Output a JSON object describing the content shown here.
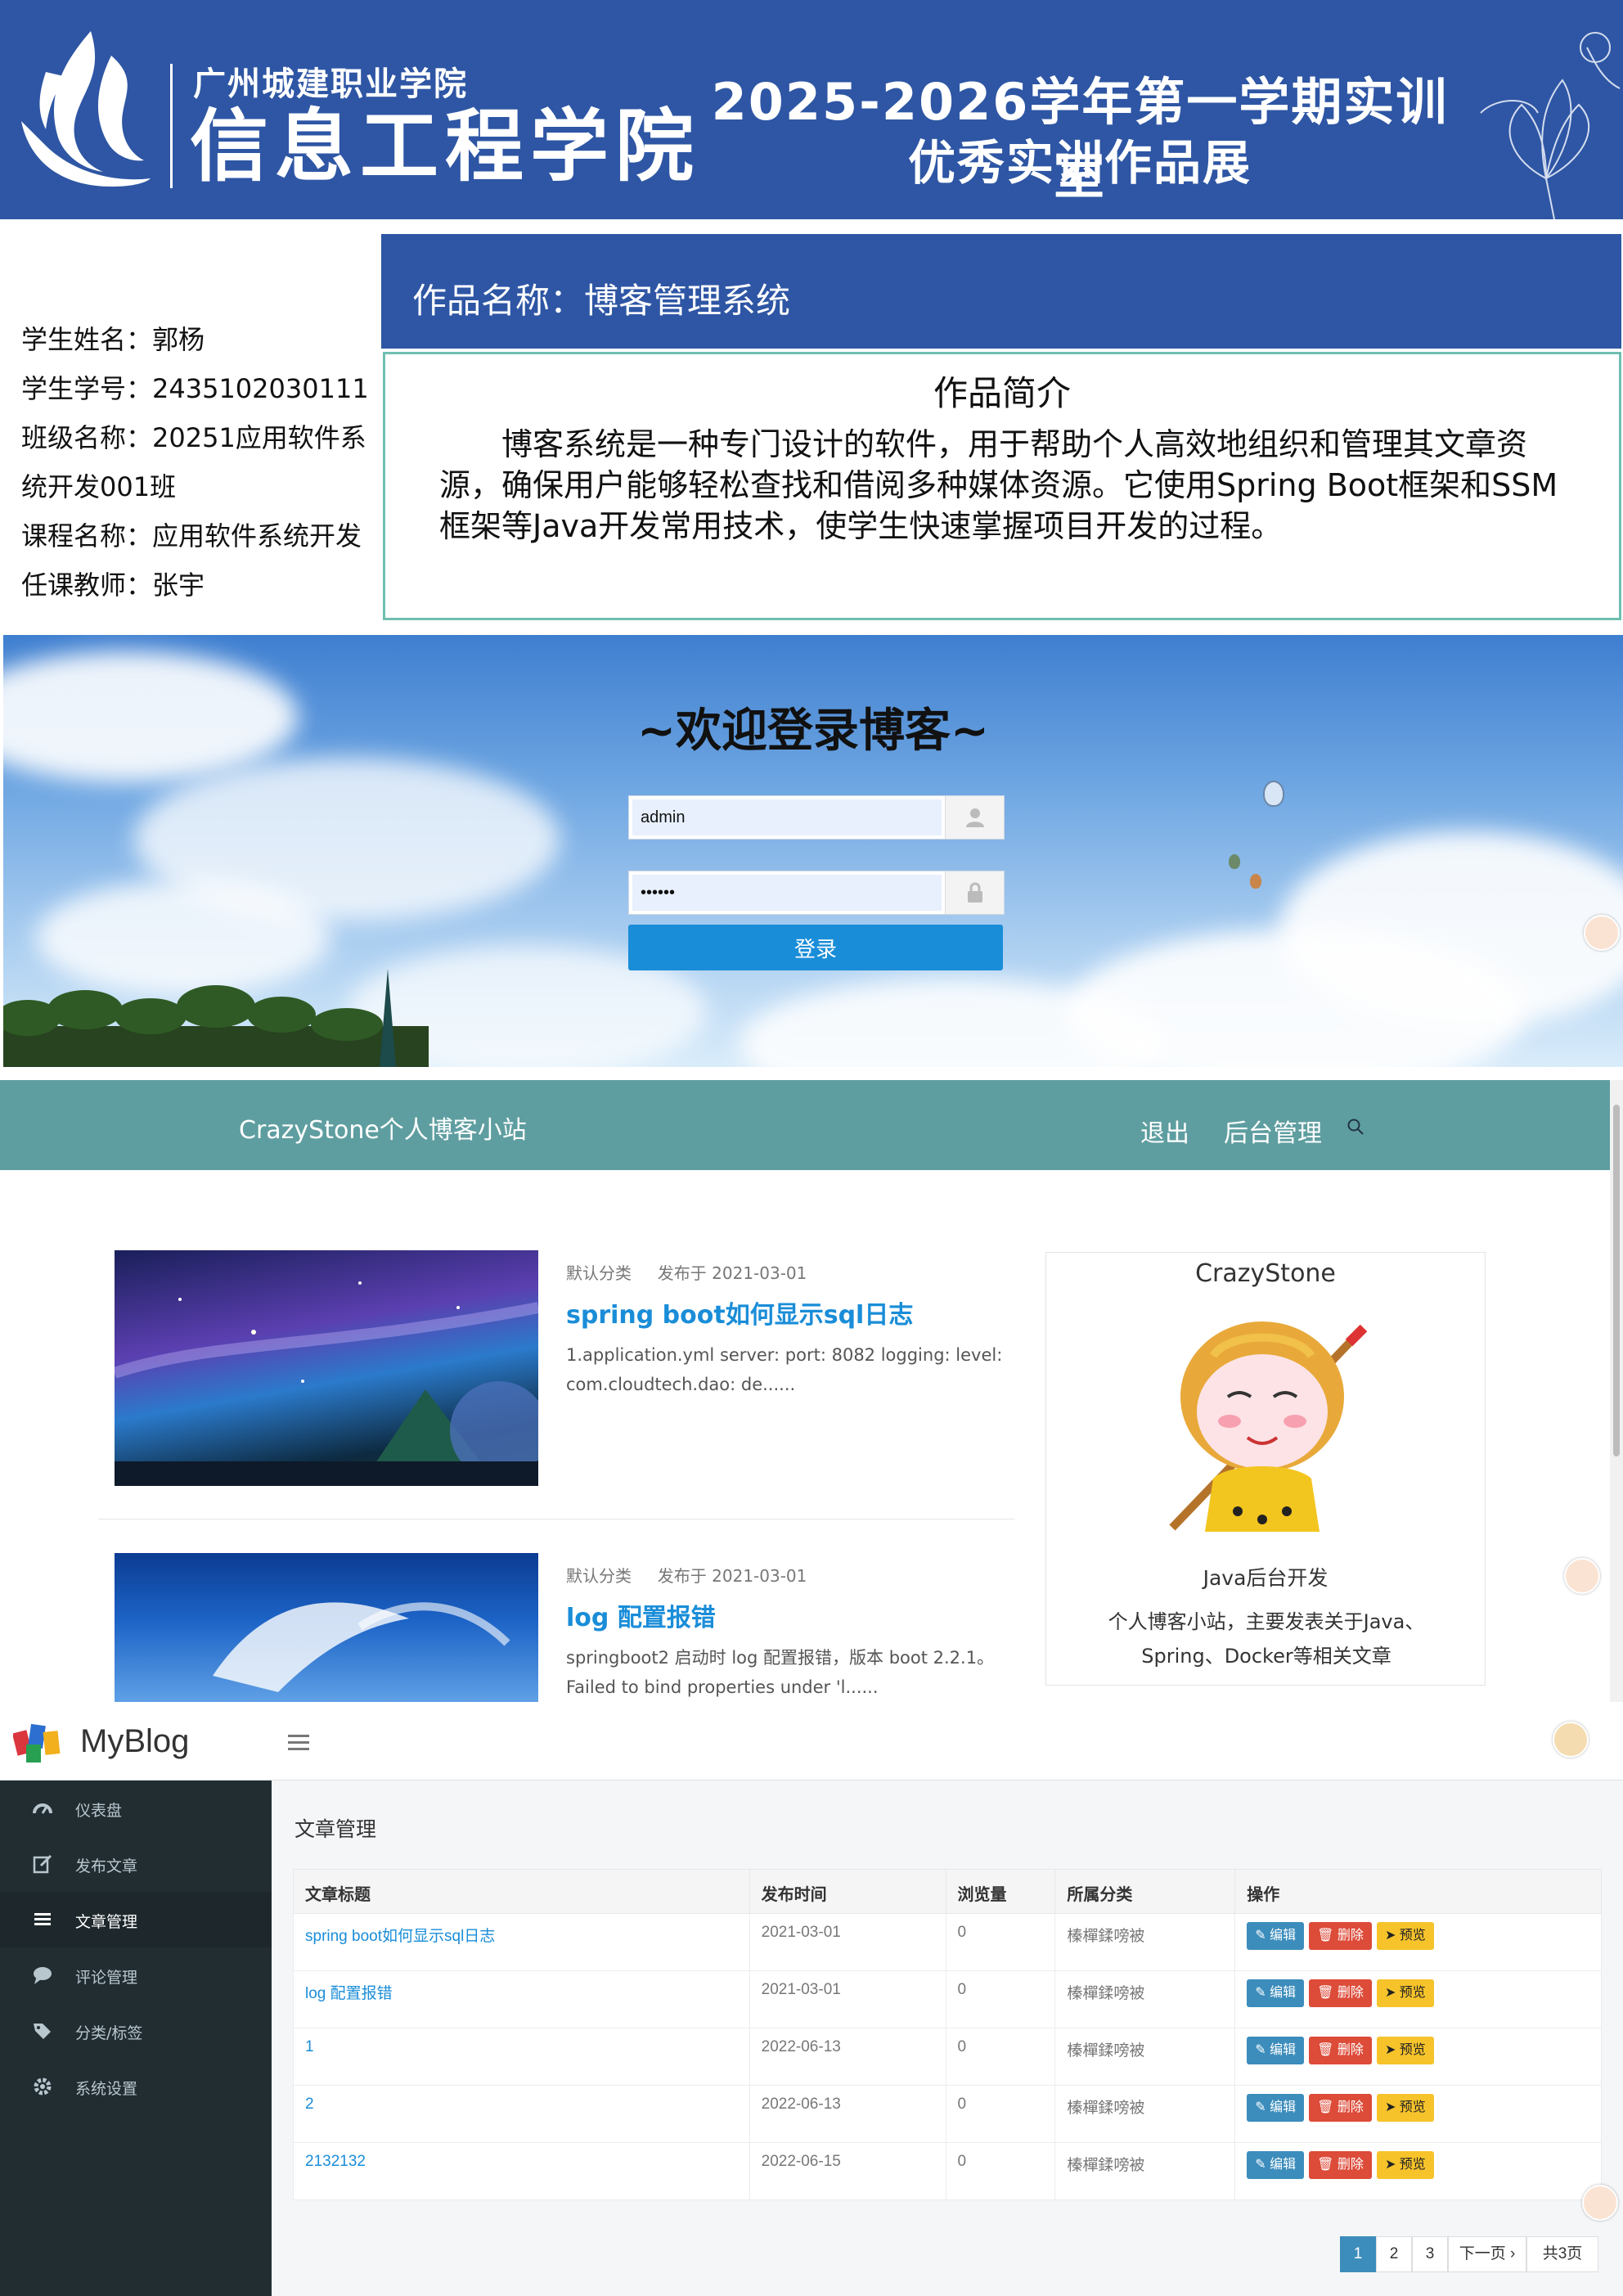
{
  "banner": {
    "school": "广州城建职业学院",
    "college": "信息工程学院",
    "title_line1": "2025-2026学年第一学期实训室",
    "title_line2": "优秀实训作品展"
  },
  "work": {
    "name": "作品名称：博客管理系统",
    "intro_title": "作品简介",
    "intro_text": "博客系统是一种专门设计的软件，用于帮助个人高效地组织和管理其文章资源，确保用户能够轻松查找和借阅多种媒体资源。它使用Spring Boot框架和SSM框架等Java开发常用技术，使学生快速掌握项目开发的过程。"
  },
  "student": {
    "name": "学生姓名：郭杨",
    "id": "学生学号：2435102030111",
    "class_line1": "班级名称：20251应用软件系",
    "class_line2": "统开发001班",
    "course": "课程名称：应用软件系统开发",
    "teacher": "任课教师：张宇"
  },
  "login": {
    "title": "~欢迎登录博客~",
    "username": "admin",
    "password": "••••••",
    "button": "登录"
  },
  "blog": {
    "brand": "CrazyStone个人博客小站",
    "nav_logout": "退出",
    "nav_admin": "后台管理",
    "posts": [
      {
        "category": "默认分类",
        "date": "发布于 2021-03-01",
        "title": "spring boot如何显示sql日志",
        "excerpt": "1.application.yml server: port: 8082 logging: level: com.cloudtech.dao: de......"
      },
      {
        "category": "默认分类",
        "date": "发布于 2021-03-01",
        "title": "log 配置报错",
        "excerpt": "springboot2 启动时 log 配置报错，版本 boot 2.2.1。 Failed to bind properties under 'l......"
      }
    ],
    "profile": {
      "name": "CrazyStone",
      "role": "Java后台开发",
      "desc": "个人博客小站，主要发表关于Java、Spring、Docker等相关文章"
    }
  },
  "admin": {
    "brand": "MyBlog",
    "menu": [
      {
        "label": "仪表盘"
      },
      {
        "label": "发布文章"
      },
      {
        "label": "文章管理"
      },
      {
        "label": "评论管理"
      },
      {
        "label": "分类/标签"
      },
      {
        "label": "系统设置"
      }
    ],
    "section_title": "文章管理",
    "table": {
      "headers": [
        "文章标题",
        "发布时间",
        "浏览量",
        "所属分类",
        "操作"
      ],
      "rows": [
        [
          "spring boot如何显示sql日志",
          "2021-03-01",
          "0",
          "榛樿鍒嗙被"
        ],
        [
          "log 配置报错",
          "2021-03-01",
          "0",
          "榛樿鍒嗙被"
        ],
        [
          "1",
          "2022-06-13",
          "0",
          "榛樿鍒嗙被"
        ],
        [
          "2",
          "2022-06-13",
          "0",
          "榛樿鍒嗙被"
        ],
        [
          "2132132",
          "2022-06-15",
          "0",
          "榛樿鍒嗙被"
        ]
      ],
      "actions": {
        "edit": "编辑",
        "delete": "删除",
        "preview": "预览"
      }
    },
    "pagination": {
      "pages": [
        "1",
        "2",
        "3"
      ],
      "next": "下一页 ›",
      "total": "共3页"
    }
  },
  "colors": {
    "banner_blue": "#2e56a4",
    "teal_nav": "#5f9ea0",
    "link_blue": "#1a8dd8",
    "sidebar_dark": "#222d32"
  }
}
